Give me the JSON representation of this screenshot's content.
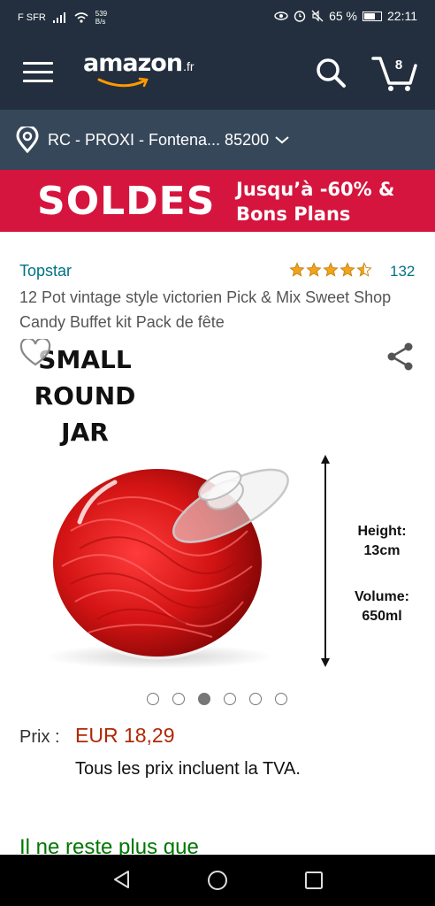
{
  "status_bar": {
    "carrier": "F SFR",
    "speed_value": "539",
    "speed_unit": "B/s",
    "battery": "65 %",
    "time": "22:11"
  },
  "header": {
    "logo_text": "amazon",
    "logo_tld": ".fr",
    "cart_count": "8"
  },
  "location": {
    "text": "RC - PROXI - Fontena... 85200"
  },
  "banner": {
    "big_text": "SOLDES",
    "line1": "Jusqu’à -60% &",
    "line2": "Bons Plans"
  },
  "product": {
    "brand": "Topstar",
    "rating": 4.5,
    "rating_count": "132",
    "title": "12 Pot vintage style victorien Pick & Mix Sweet Shop Candy Buffet kit Pack de fête",
    "image": {
      "label_line1": "SMALL",
      "label_line2": "ROUND",
      "label_line3": "JAR",
      "height_title": "Height:",
      "height_value": "13cm",
      "volume_title": "Volume:",
      "volume_value": "650ml"
    },
    "carousel": {
      "total": 6,
      "active_index": 2
    },
    "price_label": "Prix :",
    "price_value": "EUR 18,29",
    "tva_note": "Tous les prix incluent la TVA.",
    "stock_text": "Il ne reste plus que"
  },
  "colors": {
    "header_bg": "#232f3e",
    "location_bg": "#37475a",
    "banner_bg": "#d5153e",
    "link": "#007185",
    "price": "#b12704",
    "star": "#f0a41a",
    "stock": "#007600"
  },
  "icons": [
    "menu-icon",
    "search-icon",
    "cart-icon",
    "location-pin-icon",
    "chevron-down-icon",
    "heart-icon",
    "share-icon",
    "back-icon",
    "home-icon",
    "recent-apps-icon"
  ]
}
